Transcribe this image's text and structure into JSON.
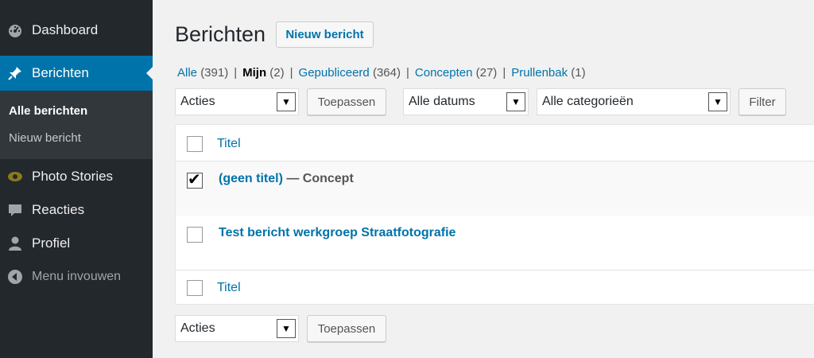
{
  "sidebar": {
    "items": [
      {
        "label": "Dashboard",
        "icon": "dashboard-icon"
      },
      {
        "label": "Berichten",
        "icon": "pin-icon"
      },
      {
        "label": "Photo Stories",
        "icon": "eye-icon"
      },
      {
        "label": "Reacties",
        "icon": "comment-icon"
      },
      {
        "label": "Profiel",
        "icon": "user-icon"
      },
      {
        "label": "Menu invouwen",
        "icon": "collapse-icon"
      }
    ],
    "submenu": [
      "Alle berichten",
      "Nieuw bericht"
    ],
    "active_color": "#0073aa",
    "bg_color": "#23282d"
  },
  "header": {
    "title": "Berichten",
    "new_button": "Nieuw bericht"
  },
  "filters": {
    "links": [
      {
        "label": "Alle",
        "count": "(391)"
      },
      {
        "label": "Mijn",
        "count": "(2)"
      },
      {
        "label": "Gepubliceerd",
        "count": "(364)"
      },
      {
        "label": "Concepten",
        "count": "(27)"
      },
      {
        "label": "Prullenbak",
        "count": "(1)"
      }
    ],
    "separator": "|"
  },
  "toolbar": {
    "bulk_action": "Acties",
    "apply": "Toepassen",
    "dates": "Alle datums",
    "categories": "Alle categorieën",
    "filter": "Filter"
  },
  "table": {
    "column_title": "Titel",
    "rows": [
      {
        "title": "(geen titel)",
        "state": " — Concept",
        "checked": true
      },
      {
        "title": "Test bericht werkgroep Straatfotografie",
        "state": "",
        "checked": false
      }
    ]
  }
}
